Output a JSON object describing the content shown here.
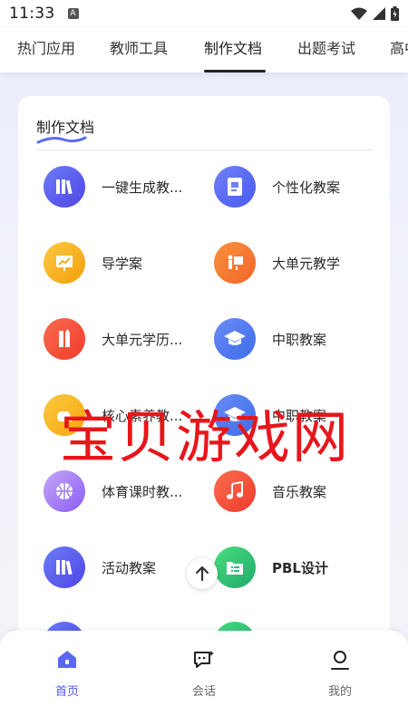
{
  "status_bar": {
    "time": "11:33",
    "a_badge": "A"
  },
  "tabs": [
    {
      "label": "热门应用"
    },
    {
      "label": "教师工具"
    },
    {
      "label": "制作文档"
    },
    {
      "label": "出题考试"
    },
    {
      "label": "高中"
    }
  ],
  "active_tab": "制作文档",
  "card": {
    "title": "制作文档",
    "items": [
      {
        "label": "一键生成教...",
        "icon": "books-icon",
        "color": "#5b5ff0"
      },
      {
        "label": "个性化教案",
        "icon": "document-icon",
        "color": "#5b6cf0"
      },
      {
        "label": "导学案",
        "icon": "presentation-icon",
        "color": "#f7b316"
      },
      {
        "label": "大单元教学",
        "icon": "teacher-board-icon",
        "color": "#f57a2a"
      },
      {
        "label": "大单元学历...",
        "icon": "ruler-pencil-icon",
        "color": "#f24a3a"
      },
      {
        "label": "中职教案",
        "icon": "graduation-cap-icon",
        "color": "#4b7bf0"
      },
      {
        "label": "核心素养教...",
        "icon": "hand-icon",
        "color": "#f5b21a"
      },
      {
        "label": "中职教案",
        "icon": "graduation-cap-icon",
        "color": "#4b7bf0"
      },
      {
        "label": "体育课时教...",
        "icon": "basketball-icon",
        "color": "#a07af0"
      },
      {
        "label": "音乐教案",
        "icon": "music-note-icon",
        "color": "#f24a3a"
      },
      {
        "label": "活动教案",
        "icon": "books-icon",
        "color": "#5b5ff0"
      },
      {
        "label": "PBL设计",
        "icon": "folder-list-icon",
        "color": "#2cc07a"
      }
    ]
  },
  "watermark": "宝贝游戏网",
  "bottom_nav": [
    {
      "label": "首页",
      "icon": "home-icon",
      "active": true
    },
    {
      "label": "会话",
      "icon": "chat-icon",
      "active": false
    },
    {
      "label": "我的",
      "icon": "profile-icon",
      "active": false
    }
  ],
  "colors": {
    "accent": "#4a58f0",
    "watermark": "#e8151b"
  }
}
